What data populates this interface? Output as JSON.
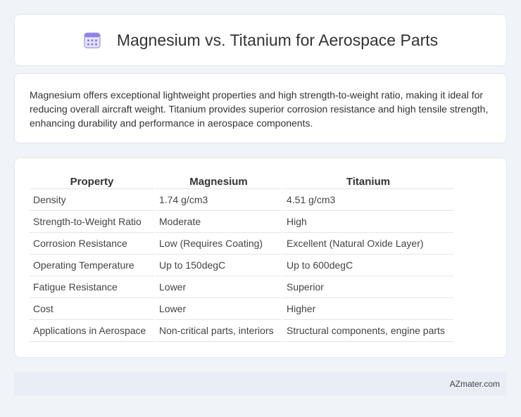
{
  "header": {
    "title": "Magnesium vs. Titanium for Aerospace Parts",
    "icon": "calendar-icon"
  },
  "description": "Magnesium offers exceptional lightweight properties and high strength-to-weight ratio, making it ideal for reducing overall aircraft weight. Titanium provides superior corrosion resistance and high tensile strength, enhancing durability and performance in aerospace components.",
  "table": {
    "headers": [
      "Property",
      "Magnesium",
      "Titanium"
    ],
    "rows": [
      [
        "Density",
        "1.74 g/cm3",
        "4.51 g/cm3"
      ],
      [
        "Strength-to-Weight Ratio",
        "Moderate",
        "High"
      ],
      [
        "Corrosion Resistance",
        "Low (Requires Coating)",
        "Excellent (Natural Oxide Layer)"
      ],
      [
        "Operating Temperature",
        "Up to 150degC",
        "Up to 600degC"
      ],
      [
        "Fatigue Resistance",
        "Lower",
        "Superior"
      ],
      [
        "Cost",
        "Lower",
        "Higher"
      ],
      [
        "Applications in Aerospace",
        "Non-critical parts, interiors",
        "Structural components, engine parts"
      ]
    ]
  },
  "footer": {
    "site": "AZmater.com"
  },
  "colors": {
    "background": "#f0f3f8",
    "card": "#ffffff",
    "footer": "#e8edf6",
    "icon_accent": "#7b6fe0"
  }
}
